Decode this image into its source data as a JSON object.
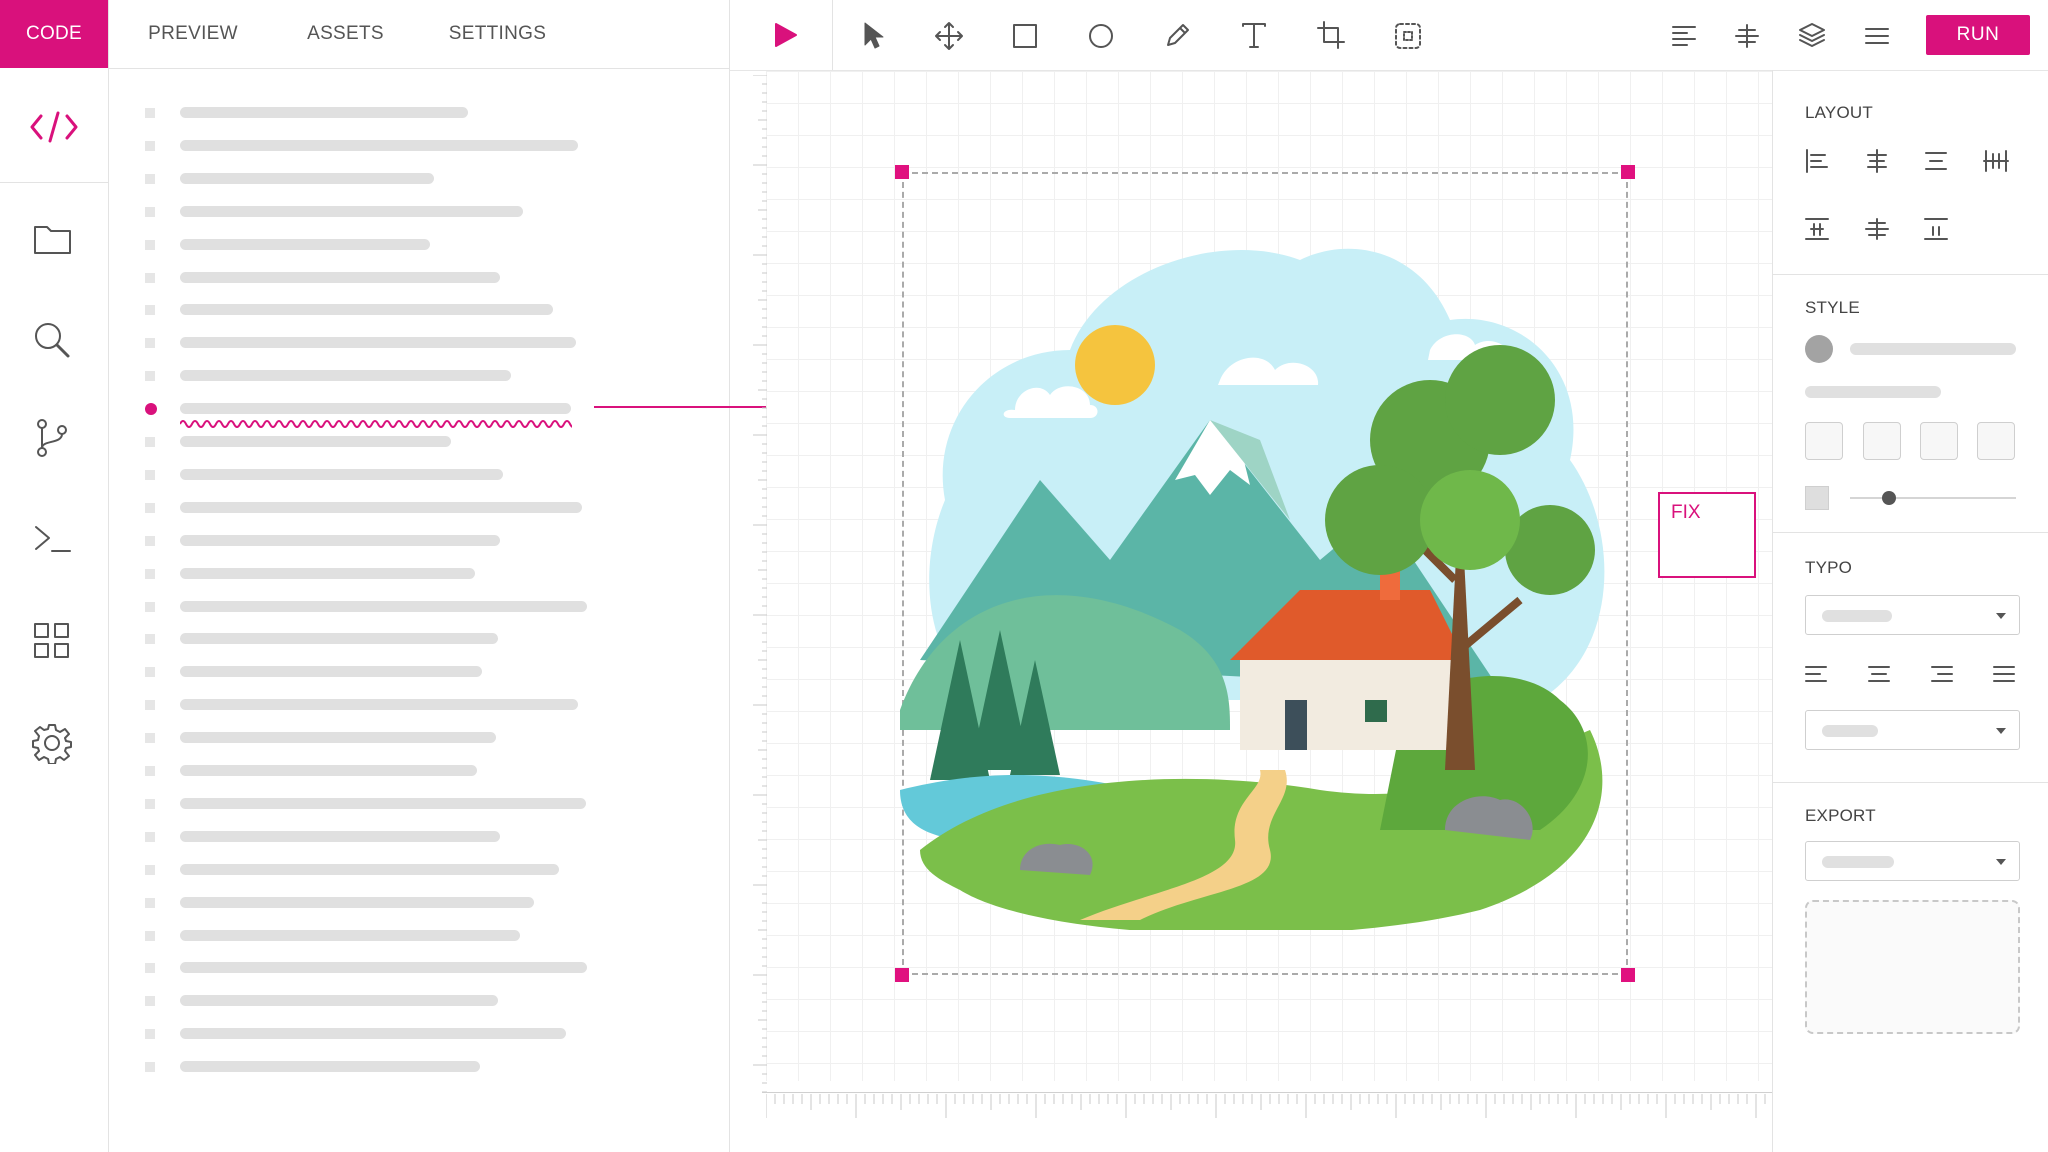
{
  "app": {
    "tabs": [
      "CODE",
      "PREVIEW",
      "ASSETS",
      "SETTINGS"
    ],
    "active_tab": "CODE"
  },
  "toolbar": {
    "run_label": "RUN",
    "tools": [
      "play-icon",
      "pointer-icon",
      "move-icon",
      "rectangle-icon",
      "ellipse-icon",
      "pen-icon",
      "text-icon",
      "crop-icon",
      "grid-select-icon"
    ],
    "right_tools": [
      "align-left-icon",
      "distribute-icon",
      "layers-icon",
      "menu-icon"
    ]
  },
  "sidebar": {
    "icons": [
      "code-icon",
      "folder-icon",
      "search-icon",
      "branch-icon",
      "terminal-icon",
      "grid-icon",
      "settings-icon"
    ]
  },
  "editor": {
    "line_count": 30,
    "error_line": 10
  },
  "canvas": {
    "annotation_label": "FIX"
  },
  "inspector": {
    "layout_title": "LAYOUT",
    "style_title": "STYLE",
    "typo_title": "TYPO",
    "export_title": "EXPORT"
  },
  "colors": {
    "accent": "#d9117c",
    "panel_border": "#e3e3e3",
    "placeholder": "#e0e0e0"
  }
}
